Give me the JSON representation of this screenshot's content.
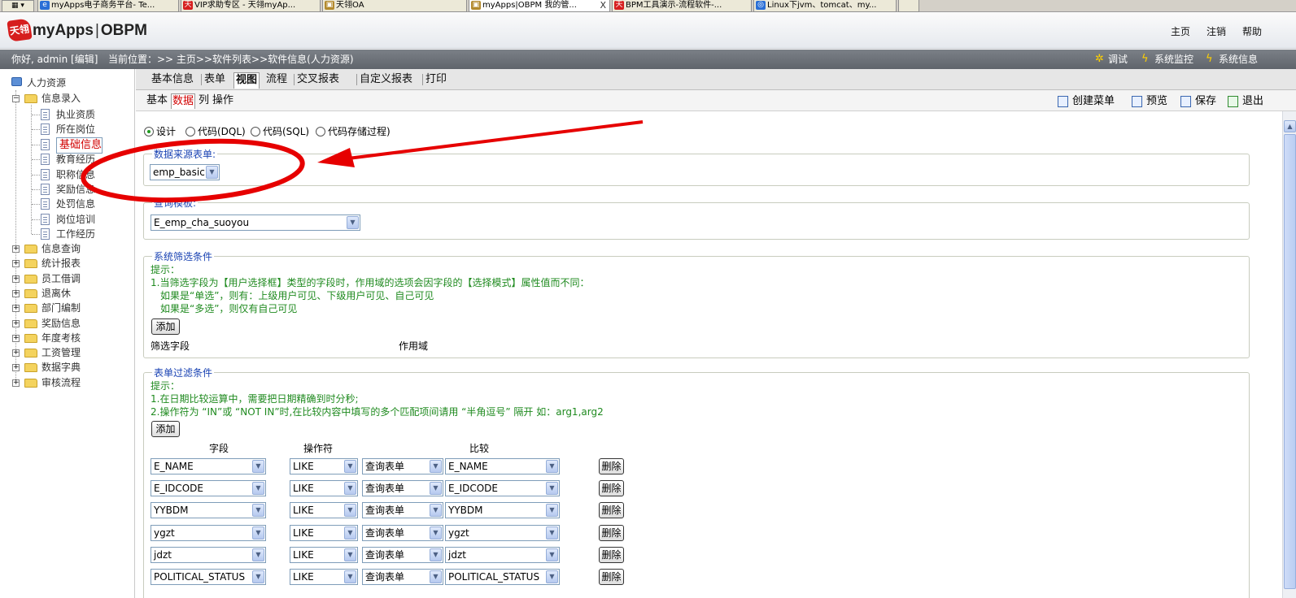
{
  "browser_tabs": [
    {
      "title": "myApps电子商务平台- Te..."
    },
    {
      "title": "VIP求助专区 - 天翎myAp..."
    },
    {
      "title": "天翎OA"
    },
    {
      "title": "myApps|OBPM 我的管...",
      "close": "X"
    },
    {
      "title": "BPM工具演示-流程软件-..."
    },
    {
      "title": "Linux下jvm、tomcat、my..."
    }
  ],
  "header": {
    "logo_mark": "天翎",
    "logo_brand": "myApps",
    "logo_sep": "|",
    "logo_product": "OBPM",
    "links": {
      "home": "主页",
      "logout": "注销",
      "help": "帮助"
    }
  },
  "infobar": {
    "greeting": "你好, admin [编辑]",
    "location": "当前位置：>> 主页>>软件列表>>软件信息(人力资源)",
    "debug": "调试",
    "monitor": "系统监控",
    "sysinfo": "系统信息"
  },
  "sidebar": {
    "root": "人力资源",
    "group_open": "信息录入",
    "children": [
      "执业资质",
      "所在岗位",
      "基础信息",
      "教育经历",
      "职称信息",
      "奖励信息",
      "处罚信息",
      "岗位培训",
      "工作经历"
    ],
    "selected_child": "基础信息",
    "groups": [
      "信息查询",
      "统计报表",
      "员工借调",
      "退离休",
      "部门编制",
      "奖励信息",
      "年度考核",
      "工资管理",
      "数据字典",
      "审核流程"
    ]
  },
  "tabs_main": [
    "基本信息",
    "表单",
    "视图",
    "流程",
    "交叉报表",
    "自定义报表",
    "打印"
  ],
  "tabs_main_active": "视图",
  "tabs_sub": [
    "基本",
    "数据",
    "列",
    "操作"
  ],
  "tabs_sub_active": "数据",
  "toolbar": {
    "create_menu": "创建菜单",
    "preview": "预览",
    "save": "保存",
    "exit": "退出"
  },
  "mode_radios": [
    {
      "label": "设计",
      "checked": true
    },
    {
      "label": "代码(DQL)",
      "checked": false
    },
    {
      "label": "代码(SQL)",
      "checked": false
    },
    {
      "label": "代码存储过程)",
      "checked": false
    }
  ],
  "data_source": {
    "legend": "数据来源表单:",
    "value": "emp_basic"
  },
  "query_form": {
    "legend": "查询模板:",
    "value": "E_emp_cha_suoyou"
  },
  "system_filter": {
    "legend": "系统筛选条件",
    "hint_title": "提示：",
    "hint_1": "1.当筛选字段为【用户选择框】类型的字段时，作用域的选项会因字段的【选择模式】属性值而不同：",
    "hint_2": "如果是“单选”，则有：上级用户可见、下级用户可见、自己可见",
    "hint_3": "如果是“多选”，则仅有自己可见",
    "add_button": "添加",
    "col_field": "筛选字段",
    "col_scope": "作用域"
  },
  "form_filter": {
    "legend": "表单过滤条件",
    "hint_title": "提示：",
    "hint_1": "1.在日期比较运算中，需要把日期精确到时分秒;",
    "hint_2": "2.操作符为 “IN”或 “NOT IN”时,在比较内容中填写的多个匹配项间请用 “半角逗号” 隔开 如：arg1,arg2",
    "add_button": "添加",
    "col_field": "字段",
    "col_operator": "操作符",
    "col_compare": "比较",
    "delete_label": "删除",
    "rows": [
      {
        "field": "E_NAME",
        "operator": "LIKE",
        "source": "查询表单",
        "compare": "E_NAME"
      },
      {
        "field": "E_IDCODE",
        "operator": "LIKE",
        "source": "查询表单",
        "compare": "E_IDCODE"
      },
      {
        "field": "YYBDM",
        "operator": "LIKE",
        "source": "查询表单",
        "compare": "YYBDM"
      },
      {
        "field": "ygzt",
        "operator": "LIKE",
        "source": "查询表单",
        "compare": "ygzt"
      },
      {
        "field": "jdzt",
        "operator": "LIKE",
        "source": "查询表单",
        "compare": "jdzt"
      },
      {
        "field": "POLITICAL_STATUS",
        "operator": "LIKE",
        "source": "查询表单",
        "compare": "POLITICAL_STATUS"
      }
    ]
  },
  "annotation_color": "#e60000"
}
